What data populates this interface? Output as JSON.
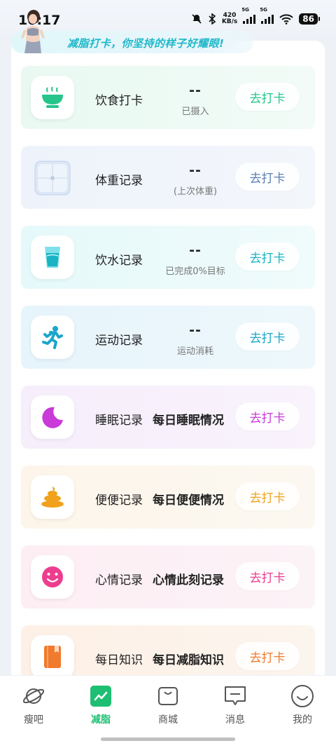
{
  "status": {
    "time": "10:17",
    "speed_top": "420",
    "speed_bottom": "KB/s",
    "net1": "5G",
    "net2": "5G",
    "battery": "86"
  },
  "banner": {
    "text": "减脂打卡，你坚持的样子好耀眼!"
  },
  "cards": [
    {
      "title": "饮食打卡",
      "value": "--",
      "sub": "已摄入",
      "button": "去打卡",
      "icon": "bowl-icon",
      "color": "#27c48c"
    },
    {
      "title": "体重记录",
      "value": "--",
      "sub": "(上次体重)",
      "button": "去打卡",
      "icon": "scale-icon",
      "color": "#5b7fb3"
    },
    {
      "title": "饮水记录",
      "value": "--",
      "sub": "已完成0%目标",
      "button": "去打卡",
      "icon": "water-glass-icon",
      "color": "#1ab3c4"
    },
    {
      "title": "运动记录",
      "value": "--",
      "sub": "运动消耗",
      "button": "去打卡",
      "icon": "running-icon",
      "color": "#1aa6c9"
    },
    {
      "title": "睡眠记录",
      "desc": "每日睡眠情况",
      "button": "去打卡",
      "icon": "moon-icon",
      "color": "#c93ad9"
    },
    {
      "title": "便便记录",
      "desc": "每日便便情况",
      "button": "去打卡",
      "icon": "poop-icon",
      "color": "#f0a21c"
    },
    {
      "title": "心情记录",
      "desc": "心情此刻记录",
      "button": "去打卡",
      "icon": "smiley-icon",
      "color": "#ec3d8f"
    },
    {
      "title": "每日知识",
      "desc": "每日减脂知识",
      "button": "去打卡",
      "icon": "book-icon",
      "color": "#f07a2d"
    }
  ],
  "nav": [
    {
      "label": "瘦吧",
      "icon": "planet-icon",
      "active": false
    },
    {
      "label": "减脂",
      "icon": "chart-trend-icon",
      "active": true
    },
    {
      "label": "商城",
      "icon": "shopping-bag-icon",
      "active": false
    },
    {
      "label": "消息",
      "icon": "message-icon",
      "active": false
    },
    {
      "label": "我的",
      "icon": "profile-smile-icon",
      "active": false
    }
  ],
  "colors": {
    "accent": "#1fbf73",
    "banner_text": "#1fb8c9"
  }
}
